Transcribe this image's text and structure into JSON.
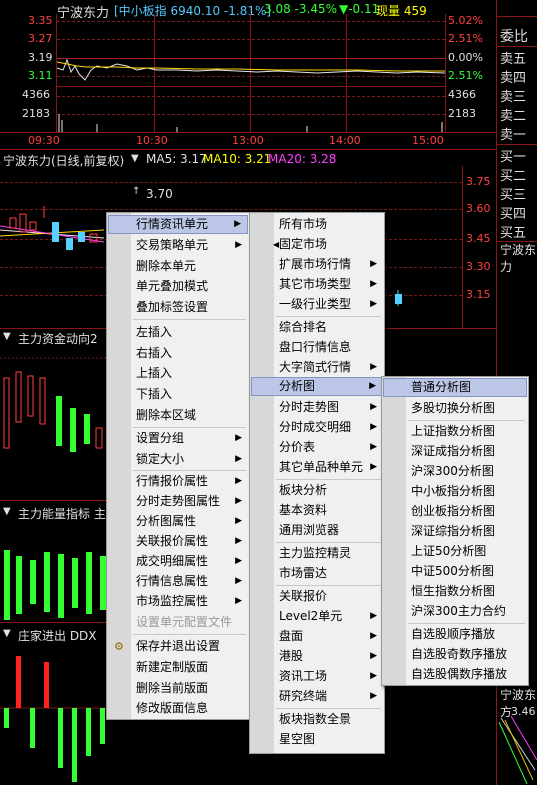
{
  "intraday": {
    "stock_name": "宁波东力",
    "index_info": "[中小板指 6940.10 -1.81%]",
    "price_info": "3.08 -3.45%",
    "change_info": "▼-0.11",
    "volume_info": "现量 459",
    "left_axis": [
      "3.35",
      "3.27",
      "3.19",
      "3.11",
      "4366",
      "2183"
    ],
    "right_axis": [
      "5.02%",
      "2.51%",
      "0.00%",
      "2.51%",
      "4366",
      "2183"
    ],
    "time_labels": [
      "09:30",
      "10:30",
      "13:00",
      "14:00",
      "15:00"
    ]
  },
  "order_book": {
    "title": "委比",
    "sell": [
      "卖五",
      "卖四",
      "卖三",
      "卖二",
      "卖一"
    ],
    "buy": [
      "买一",
      "买二",
      "买三",
      "买四",
      "买五"
    ],
    "name_bottom": "宁波东力",
    "name_lower": "宁波东方",
    "price_lower": "3.46"
  },
  "daily": {
    "title": "宁波东力(日线,前复权)",
    "ma5": "MA5: 3.17",
    "ma10": "MA10: 3.21",
    "ma20": "MA20: 3.28",
    "high_mark": "3.70",
    "axis": [
      "3.75",
      "3.60",
      "3.45",
      "3.30",
      "3.15"
    ]
  },
  "indicators": {
    "fund_flow": "主力资金动向2",
    "energy": "主力能量指标 主",
    "dealer": "庄家进出 DDX"
  },
  "menu1": {
    "items": [
      "行情资讯单元",
      "交易策略单元",
      "删除本单元",
      "单元叠加模式",
      "叠加标签设置",
      "左插入",
      "右插入",
      "上插入",
      "下插入",
      "删除本区域",
      "设置分组",
      "锁定大小",
      "行情报价属性",
      "分时走势图属性",
      "分析图属性",
      "关联报价属性",
      "成交明细属性",
      "行情信息属性",
      "市场监控属性",
      "设置单元配置文件",
      "保存并退出设置",
      "新建定制版面",
      "删除当前版面",
      "修改版面信息"
    ]
  },
  "menu2": {
    "items": [
      "所有市场",
      "固定市场",
      "扩展市场行情",
      "其它市场类型",
      "一级行业类型",
      "综合排名",
      "盘口行情信息",
      "大字简式行情",
      "分析图",
      "分时走势图",
      "分时成交明细",
      "分价表",
      "其它单品种单元",
      "板块分析",
      "基本资料",
      "通用浏览器",
      "主力监控精灵",
      "市场雷达",
      "关联报价",
      "Level2单元",
      "盘面",
      "港股",
      "资讯工场",
      "研究终端",
      "板块指数全景",
      "星空图"
    ]
  },
  "menu3": {
    "items": [
      "普通分析图",
      "多股切换分析图",
      "上证指数分析图",
      "深证成指分析图",
      "沪深300分析图",
      "中小板指分析图",
      "创业板指分析图",
      "深证综指分析图",
      "上证50分析图",
      "中证500分析图",
      "恒生指数分析图",
      "沪深300主力合约",
      "自选股顺序播放",
      "自选股奇数序播放",
      "自选股偶数序播放"
    ]
  }
}
